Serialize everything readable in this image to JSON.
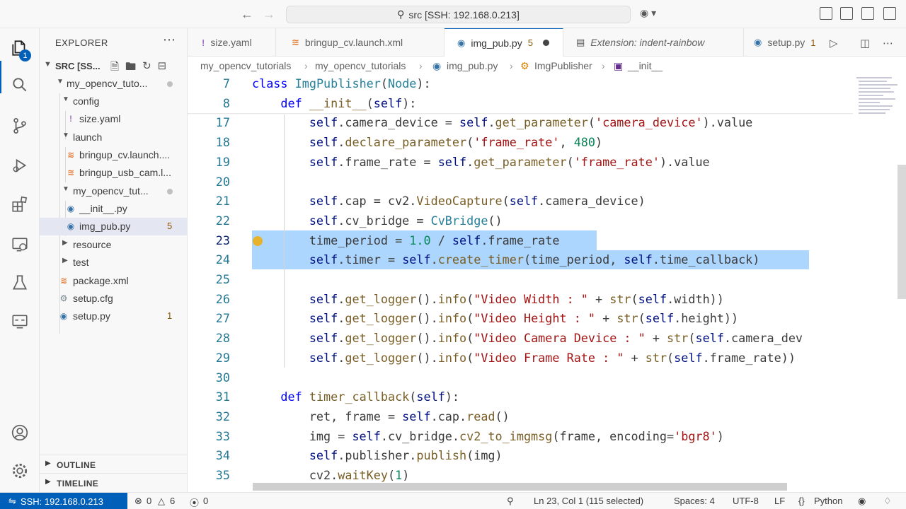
{
  "titlebar": {
    "command_center": "src [SSH: 192.168.0.213]"
  },
  "activity": {
    "explorer_badge": "1"
  },
  "sidebar": {
    "title": "EXPLORER",
    "root_label": "SRC [SS...",
    "items": [
      {
        "label": "my_opencv_tuto...",
        "kind": "folder"
      },
      {
        "label": "config",
        "kind": "folder"
      },
      {
        "label": "size.yaml",
        "kind": "yaml"
      },
      {
        "label": "launch",
        "kind": "folder"
      },
      {
        "label": "bringup_cv.launch....",
        "kind": "xml"
      },
      {
        "label": "bringup_usb_cam.l...",
        "kind": "xml"
      },
      {
        "label": "my_opencv_tut...",
        "kind": "folder"
      },
      {
        "label": "__init__.py",
        "kind": "py"
      },
      {
        "label": "img_pub.py",
        "kind": "py",
        "count": "5"
      },
      {
        "label": "resource",
        "kind": "folder"
      },
      {
        "label": "test",
        "kind": "folder"
      },
      {
        "label": "package.xml",
        "kind": "xml"
      },
      {
        "label": "setup.cfg",
        "kind": "cfg"
      },
      {
        "label": "setup.py",
        "kind": "py",
        "count": "1"
      }
    ],
    "outline_label": "OUTLINE",
    "timeline_label": "TIMELINE"
  },
  "tabs": [
    {
      "label": "size.yaml",
      "icon": "!"
    },
    {
      "label": "bringup_cv.launch.xml",
      "icon": "xml"
    },
    {
      "label": "img_pub.py",
      "icon": "py",
      "count": "5"
    },
    {
      "label": "Extension: indent-rainbow",
      "icon": "ext"
    },
    {
      "label": "setup.py",
      "icon": "py",
      "count": "1"
    }
  ],
  "breadcrumbs": [
    "my_opencv_tutorials",
    "my_opencv_tutorials",
    "img_pub.py",
    "ImgPublisher",
    "__init__"
  ],
  "code_lines": [
    {
      "num": "7",
      "text": "class ImgPublisher(Node):"
    },
    {
      "num": "8",
      "text": "    def __init__(self):"
    },
    {
      "num": "17",
      "text": "        self.camera_device = self.get_parameter('camera_device').value"
    },
    {
      "num": "18",
      "text": "        self.declare_parameter('frame_rate', 480)"
    },
    {
      "num": "19",
      "text": "        self.frame_rate = self.get_parameter('frame_rate').value"
    },
    {
      "num": "20",
      "text": ""
    },
    {
      "num": "21",
      "text": "        self.cap = cv2.VideoCapture(self.camera_device)"
    },
    {
      "num": "22",
      "text": "        self.cv_bridge = CvBridge()"
    },
    {
      "num": "23",
      "text": "        time_period = 1.0 / self.frame_rate"
    },
    {
      "num": "24",
      "text": "        self.timer = self.create_timer(time_period, self.time_callback)"
    },
    {
      "num": "25",
      "text": ""
    },
    {
      "num": "26",
      "text": "        self.get_logger().info(\"Video Width : \" + str(self.width))"
    },
    {
      "num": "27",
      "text": "        self.get_logger().info(\"Video Height : \" + str(self.height))"
    },
    {
      "num": "28",
      "text": "        self.get_logger().info(\"Video Camera Device : \" + str(self.camera_dev"
    },
    {
      "num": "29",
      "text": "        self.get_logger().info(\"Video Frame Rate : \" + str(self.frame_rate))"
    },
    {
      "num": "30",
      "text": ""
    },
    {
      "num": "31",
      "text": "    def timer_callback(self):"
    },
    {
      "num": "32",
      "text": "        ret, frame = self.cap.read()"
    },
    {
      "num": "33",
      "text": "        img = self.cv_bridge.cv2_to_imgmsg(frame, encoding='bgr8')"
    },
    {
      "num": "34",
      "text": "        self.publisher.publish(img)"
    },
    {
      "num": "35",
      "text": "        cv2.waitKey(1)"
    }
  ],
  "status": {
    "remote": "SSH: 192.168.0.213",
    "errors": "0",
    "warnings": "6",
    "ports": "0",
    "position": "Ln 23, Col 1 (115 selected)",
    "spaces": "Spaces: 4",
    "encoding": "UTF-8",
    "eol": "LF",
    "language": "Python"
  },
  "colors": {
    "accent": "#005fb8",
    "selection": "#add6ff",
    "keyword": "#0000ff",
    "string": "#a31515",
    "number": "#098658",
    "function": "#795e26"
  }
}
